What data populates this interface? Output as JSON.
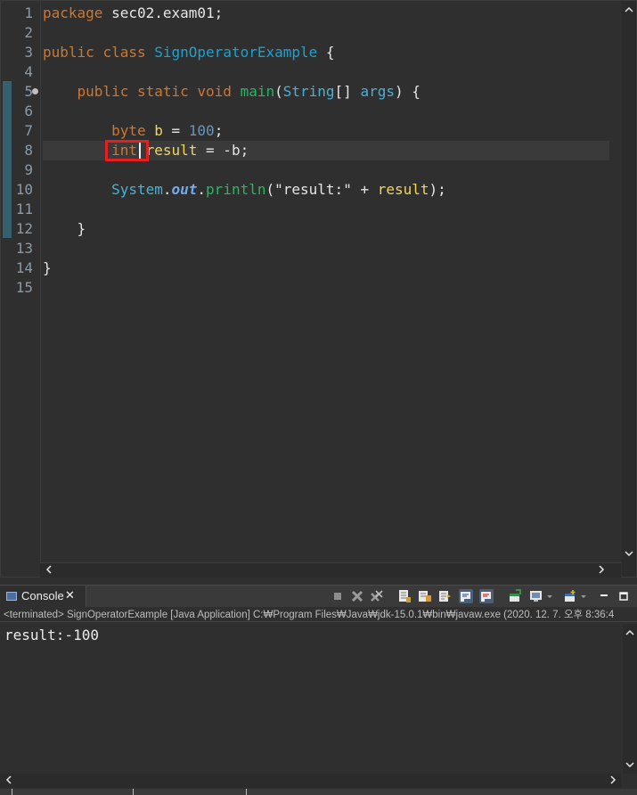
{
  "editor": {
    "line_numbers": [
      "1",
      "2",
      "3",
      "4",
      "5",
      "6",
      "7",
      "8",
      "9",
      "10",
      "11",
      "12",
      "13",
      "14",
      "15"
    ],
    "lines": {
      "l1": {
        "kw": "package",
        "rest": " sec02.exam01;"
      },
      "l3": {
        "kw1": "public",
        "kw2": "class",
        "cls": "SignOperatorExample",
        "rest": " {"
      },
      "l5": {
        "kw1": "public",
        "kw2": "static",
        "kw3": "void",
        "mth": "main",
        "p1": "(",
        "cls": "String",
        "p2": "[] ",
        "var": "args",
        "p3": ") {"
      },
      "l7": {
        "kw": "byte",
        "var": "b",
        "p1": " = ",
        "num": "100",
        "p2": ";"
      },
      "l8": {
        "kw": "int",
        "var": "result",
        "p1": " = -b;"
      },
      "l10": {
        "cls": "System",
        "p1": ".",
        "fld": "out",
        "p2": ".",
        "mth": "println",
        "p3": "(",
        "str": "\"result:\"",
        "p4": " + ",
        "var": "result",
        "p5": ");"
      },
      "l12": {
        "brace": "}"
      },
      "l14": {
        "brace": "}"
      }
    },
    "scroll": {
      "up": "^",
      "down": "v",
      "left": "<",
      "right": ">"
    }
  },
  "console": {
    "tab_label": "Console",
    "tab_close": "✕",
    "status_text": "<terminated> SignOperatorExample [Java Application] C:₩Program Files₩Java₩jdk-15.0.1₩bin₩javaw.exe  (2020. 12. 7. 오후 8:36:4",
    "output": "result:-100",
    "toolbar_icons": [
      "terminate-icon",
      "remove-launch-icon",
      "remove-all-terminated-icon",
      "clear-console-icon",
      "scroll-lock-icon",
      "word-wrap-icon",
      "show-console-on-output-icon",
      "show-console-on-error-icon",
      "pin-console-icon",
      "display-selected-console-icon",
      "open-console-icon",
      "minimize-icon",
      "maximize-icon"
    ]
  },
  "colors": {
    "background": "#2f2f2f",
    "keyword": "#cc7832",
    "class": "#1aa3d2",
    "method": "#26b85f",
    "variable": "#f2d55d",
    "number": "#6897bb",
    "highlight_box": "#e51f1f"
  }
}
